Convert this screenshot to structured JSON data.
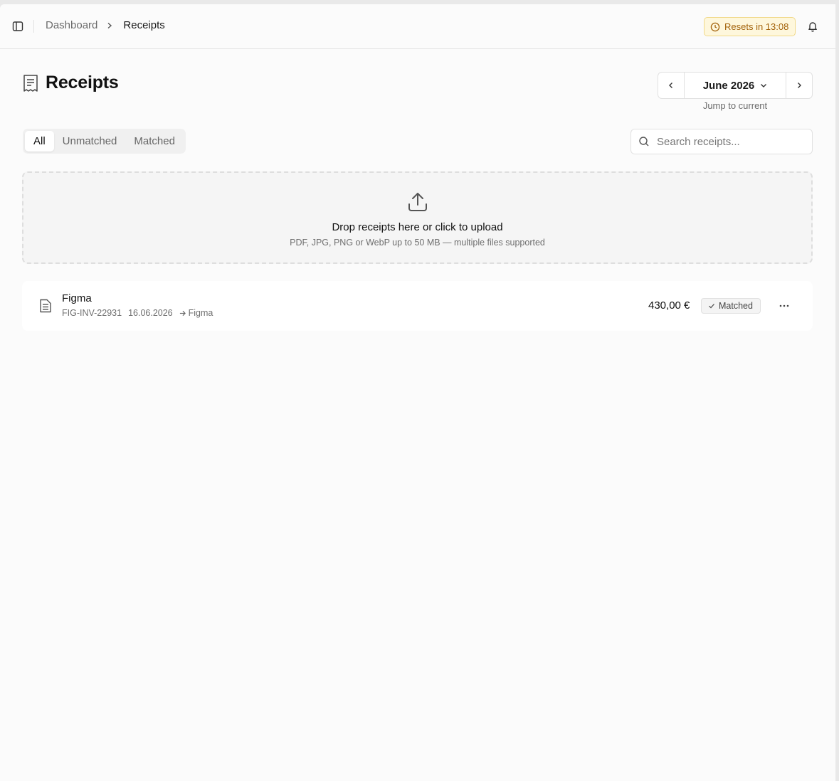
{
  "header": {
    "breadcrumb": {
      "parent": "Dashboard",
      "current": "Receipts"
    },
    "reset_badge": "Resets in 13:08",
    "icons": {
      "sidebar": "sidebar-toggle-icon",
      "clock": "clock-icon",
      "bell": "bell-icon"
    }
  },
  "page": {
    "title": "Receipts",
    "title_icon": "receipt-icon"
  },
  "month_nav": {
    "month": "June 2026",
    "jump_label": "Jump to current"
  },
  "tabs": [
    {
      "label": "All",
      "active": true
    },
    {
      "label": "Unmatched",
      "active": false
    },
    {
      "label": "Matched",
      "active": false
    }
  ],
  "search": {
    "placeholder": "Search receipts...",
    "value": ""
  },
  "dropzone": {
    "title": "Drop receipts here or click to upload",
    "subtitle": "PDF, JPG, PNG or WebP up to 50 MB — multiple files supported"
  },
  "receipts": [
    {
      "name": "Figma",
      "invoice": "FIG-INV-22931",
      "date": "16.06.2026",
      "matched_to": "Figma",
      "amount": "430,00 €",
      "status": "Matched"
    }
  ],
  "colors": {
    "badge_bg": "#fef7dc",
    "badge_text": "#a3620a",
    "page_bg": "#fbfbfb"
  }
}
